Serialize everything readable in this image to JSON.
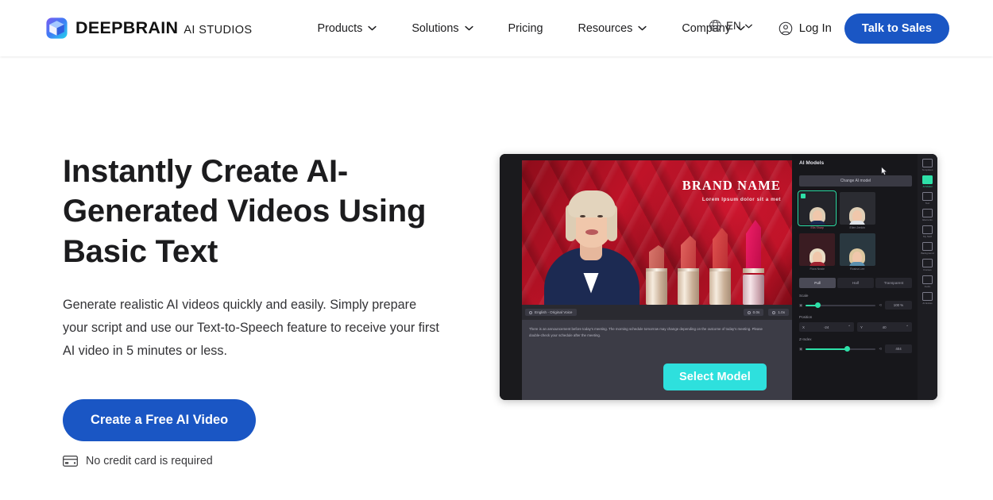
{
  "header": {
    "brand": {
      "name": "DEEPBRAIN",
      "sub": "AI STUDIOS",
      "logo_icon": "cube-logo-icon"
    },
    "nav": [
      {
        "label": "Products",
        "has_caret": true
      },
      {
        "label": "Solutions",
        "has_caret": true
      },
      {
        "label": "Pricing",
        "has_caret": false
      },
      {
        "label": "Resources",
        "has_caret": true
      },
      {
        "label": "Company",
        "has_caret": true
      }
    ],
    "language": {
      "label": "EN",
      "icon": "globe-icon"
    },
    "login": {
      "label": "Log In",
      "icon": "user-circle-icon"
    },
    "cta": {
      "label": "Talk to Sales"
    }
  },
  "hero": {
    "title": "Instantly Create AI-Generated Videos Using Basic Text",
    "description": "Generate realistic AI videos quickly and easily. Simply prepare your script and use our Text-to-Speech feature to receive your first AI video in 5 minutes or less.",
    "cta_label": "Create a Free AI Video",
    "note": "No credit card is required",
    "note_icon": "credit-card-icon"
  },
  "preview": {
    "stage": {
      "brand_name": "BRAND NAME",
      "brand_tagline": "Lorem Ipsum dolor sit a met"
    },
    "toolbar": {
      "language_chip": "English - Original Voice",
      "time_a": "0.0s",
      "time_b": "1.0x"
    },
    "script": "There is an announcement before today's meeting. The morning schedule tomorrow may change depending on the outcome of today's meeting. Please double-check your schedule after the meeting.",
    "select_model_label": "Select Model",
    "panel": {
      "title": "AI Models",
      "change_model_label": "Change AI model",
      "models": [
        {
          "name": "Ella Sharp",
          "selected": true,
          "hair": "#ddcdb4",
          "shirt": "#1c2a52",
          "bg": "#23242a",
          "label_color": "#d6607a"
        },
        {
          "name": "Ellen Jenkin",
          "selected": false,
          "hair": "#e0cfb6",
          "shirt": "#dfe3e8",
          "bg": "#2b2c32",
          "label_color": "#8a8a96"
        },
        {
          "name": "Flora Neale",
          "selected": false,
          "hair": "#e8dcc4",
          "shirt": "#9e2230",
          "bg": "#3a1c22",
          "label_color": "#8a8a96"
        },
        {
          "name": "Rosina Lee",
          "selected": false,
          "hair": "#dcc79f",
          "shirt": "#5b8fae",
          "bg": "#2a3840",
          "label_color": "#8a8a96"
        }
      ],
      "segments": [
        {
          "label": "Full",
          "active": true
        },
        {
          "label": "Half",
          "active": false
        },
        {
          "label": "Transparent",
          "active": false
        }
      ],
      "scale": {
        "label": "Scale",
        "value": "100 %",
        "fill_pct": 16
      },
      "position": {
        "label": "Position",
        "x_label": "X",
        "x_value": "-24",
        "y_label": "Y",
        "y_value": "40"
      },
      "z_index": {
        "label": "Z-Index",
        "value": "404",
        "fill_pct": 58
      }
    },
    "rail": [
      {
        "label": "Templates",
        "active": false
      },
      {
        "label": "AI Model",
        "active": true
      },
      {
        "label": "Text",
        "active": false
      },
      {
        "label": "Elements",
        "active": false
      },
      {
        "label": "My Stuff",
        "active": false
      },
      {
        "label": "Background",
        "active": false
      },
      {
        "label": "Frames",
        "active": false
      },
      {
        "label": "Audio",
        "active": false
      },
      {
        "label": "AI Extras",
        "active": false
      }
    ]
  },
  "colors": {
    "brand_blue": "#1a56c4",
    "accent_cyan": "#2ee0dd",
    "accent_green": "#2ee0a8"
  }
}
